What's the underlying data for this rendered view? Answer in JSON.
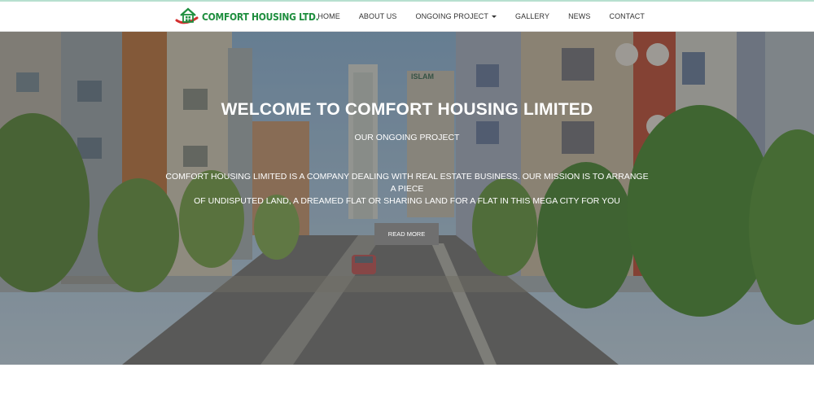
{
  "site": {
    "brand_name": "COMFORT HOUSING LTD.",
    "brand_color": "#1e8e3e",
    "logo_accent": "#d32f2f"
  },
  "nav": {
    "items": [
      {
        "label": "HOME"
      },
      {
        "label": "ABOUT US"
      },
      {
        "label": "ONGOING PROJECT",
        "has_dropdown": true
      },
      {
        "label": "GALLERY"
      },
      {
        "label": "NEWS"
      },
      {
        "label": "CONTACT"
      }
    ]
  },
  "hero": {
    "title": "WELCOME TO COMFORT HOUSING LIMITED",
    "subtitle": "OUR ONGOING PROJECT",
    "description_line1": "COMFORT HOUSING LIMITED IS A COMPANY DEALING WITH REAL ESTATE BUSINESS. OUR MISSION IS TO ARRANGE A PIECE",
    "description_line2": "OF UNDISPUTED LAND, A DREAMED FLAT OR SHARING LAND FOR A FLAT IN THIS MEGA CITY FOR YOU",
    "button_label": "READ MORE",
    "background_sign": "ISLAM"
  }
}
